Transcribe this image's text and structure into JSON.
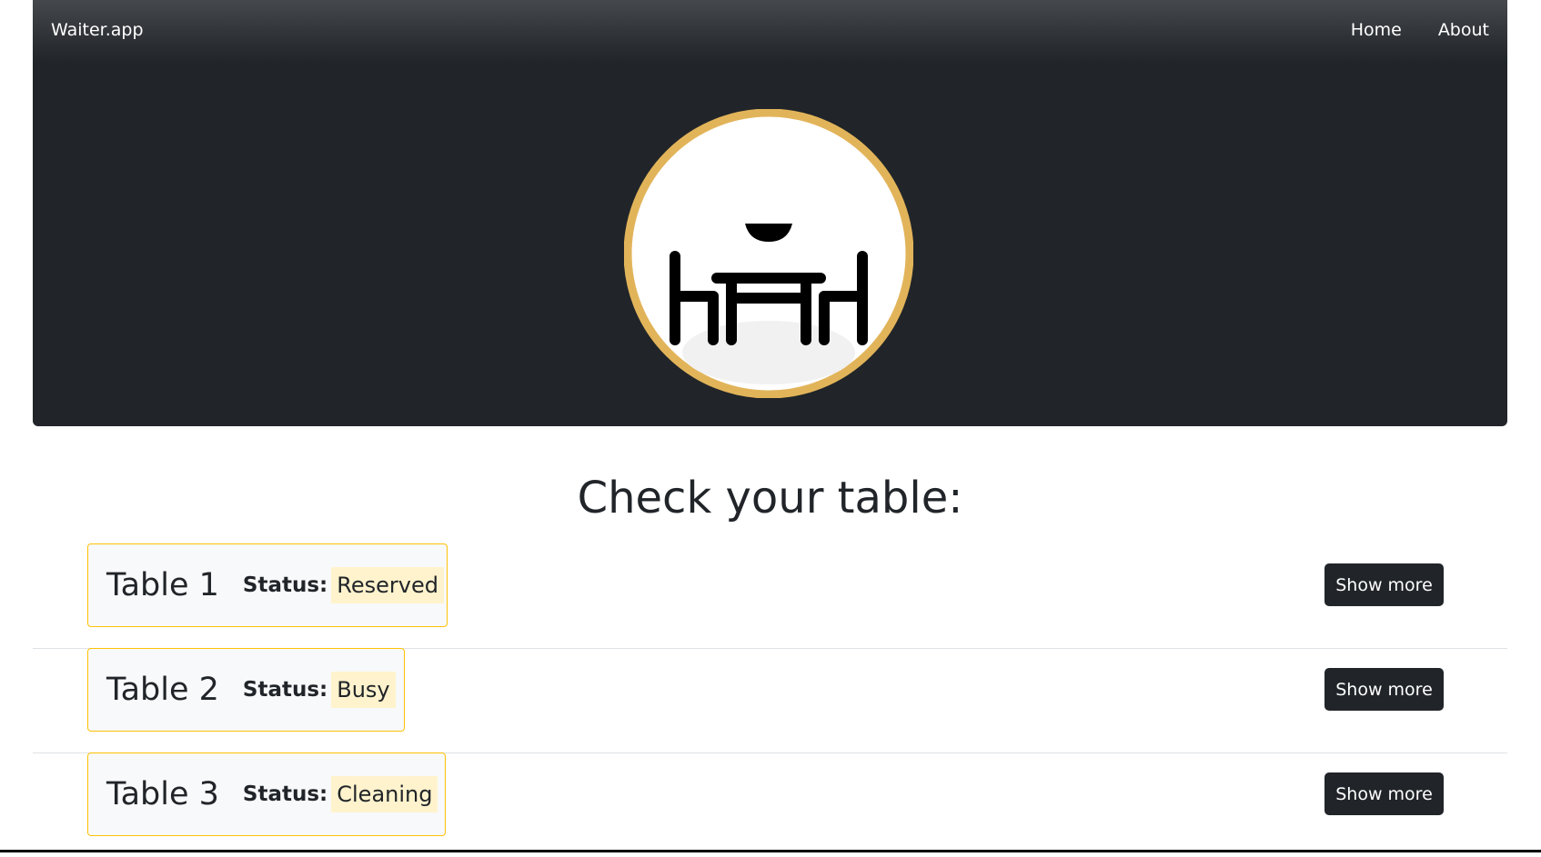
{
  "navbar": {
    "brand": "Waiter.app",
    "links": [
      "Home",
      "About"
    ]
  },
  "hero": {
    "logo": "table-chairs-icon",
    "ring_color": "#e2b45a"
  },
  "main": {
    "heading": "Check your table:",
    "status_label": "Status:",
    "show_more_label": "Show more",
    "tables": [
      {
        "name": "Table 1",
        "status": "Reserved"
      },
      {
        "name": "Table 2",
        "status": "Busy"
      },
      {
        "name": "Table 3",
        "status": "Cleaning"
      }
    ]
  },
  "colors": {
    "dark": "#212529",
    "warning": "#ffc107",
    "warning_bg": "#fff3cd"
  }
}
